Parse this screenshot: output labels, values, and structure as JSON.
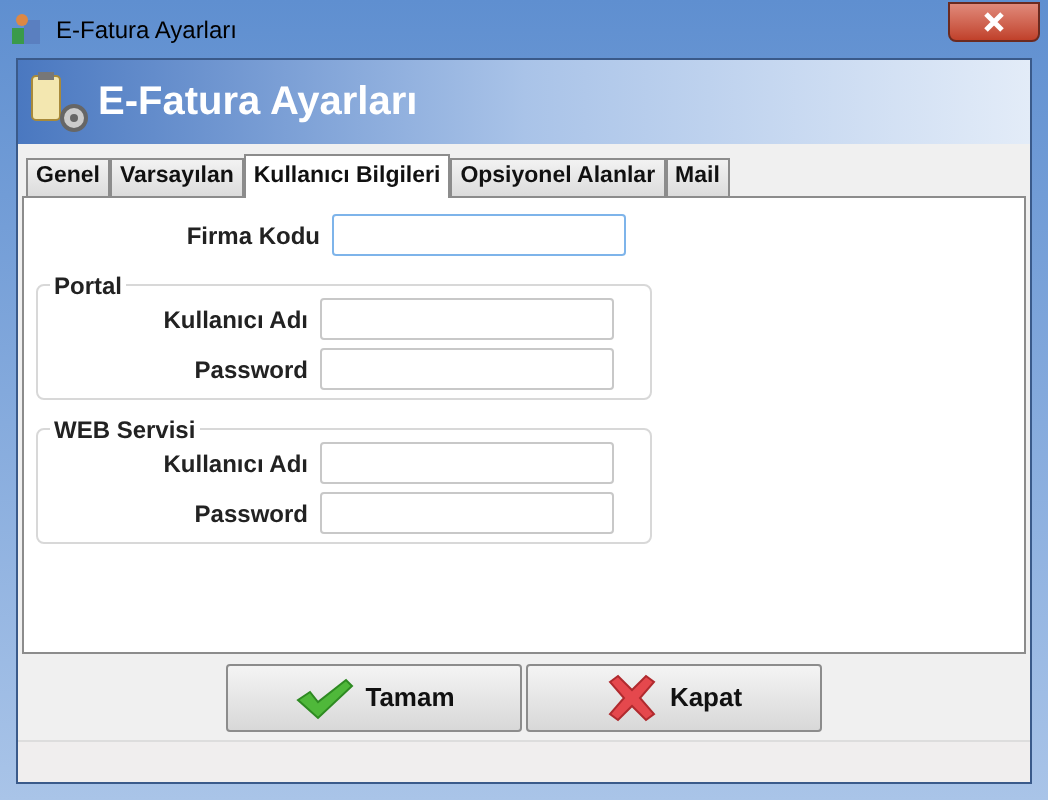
{
  "window": {
    "title": "E-Fatura Ayarları"
  },
  "header": {
    "title": "E-Fatura Ayarları"
  },
  "tabs": [
    {
      "label": "Genel",
      "selected": false
    },
    {
      "label": "Varsayılan",
      "selected": false
    },
    {
      "label": "Kullanıcı Bilgileri",
      "selected": true
    },
    {
      "label": "Opsiyonel Alanlar",
      "selected": false
    },
    {
      "label": "Mail",
      "selected": false
    }
  ],
  "firm_code": {
    "label": "Firma Kodu"
  },
  "groups": [
    {
      "title": "Portal",
      "fields": [
        {
          "label": "Kullanıcı Adı"
        },
        {
          "label": "Password"
        }
      ]
    },
    {
      "title": "WEB Servisi",
      "fields": [
        {
          "label": "Kullanıcı Adı"
        },
        {
          "label": "Password"
        }
      ]
    }
  ],
  "buttons": [
    {
      "label": "Tamam",
      "kind": "ok"
    },
    {
      "label": "Kapat",
      "kind": "close"
    }
  ]
}
